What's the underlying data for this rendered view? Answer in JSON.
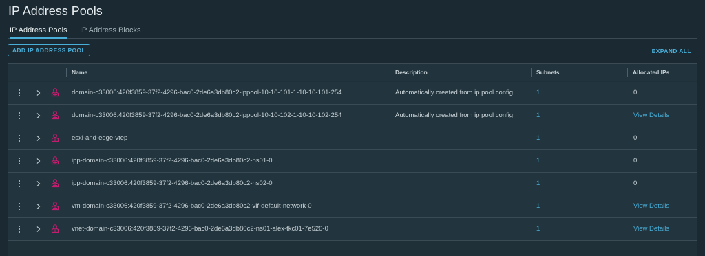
{
  "page": {
    "title": "IP Address Pools"
  },
  "tabs": [
    {
      "label": "IP Address Pools",
      "active": true
    },
    {
      "label": "IP Address Blocks",
      "active": false
    }
  ],
  "toolbar": {
    "add_label": "ADD IP ADDRESS POOL",
    "expand_all_label": "EXPAND ALL"
  },
  "grid": {
    "columns": [
      "Name",
      "Description",
      "Subnets",
      "Allocated IPs"
    ],
    "rows": [
      {
        "name": "domain-c33006:420f3859-37f2-4296-bac0-2de6a3db80c2-ippool-10-10-101-1-10-10-101-254",
        "description": "Automatically created from ip pool config",
        "subnets": "1",
        "allocated": "0",
        "allocated_is_link": false
      },
      {
        "name": "domain-c33006:420f3859-37f2-4296-bac0-2de6a3db80c2-ippool-10-10-102-1-10-10-102-254",
        "description": "Automatically created from ip pool config",
        "subnets": "1",
        "allocated": "View Details",
        "allocated_is_link": true
      },
      {
        "name": "esxi-and-edge-vtep",
        "description": "",
        "subnets": "1",
        "allocated": "0",
        "allocated_is_link": false
      },
      {
        "name": "ipp-domain-c33006:420f3859-37f2-4296-bac0-2de6a3db80c2-ns01-0",
        "description": "",
        "subnets": "1",
        "allocated": "0",
        "allocated_is_link": false
      },
      {
        "name": "ipp-domain-c33006:420f3859-37f2-4296-bac0-2de6a3db80c2-ns02-0",
        "description": "",
        "subnets": "1",
        "allocated": "0",
        "allocated_is_link": false
      },
      {
        "name": "vm-domain-c33006:420f3859-37f2-4296-bac0-2de6a3db80c2-vif-default-network-0",
        "description": "",
        "subnets": "1",
        "allocated": "View Details",
        "allocated_is_link": true
      },
      {
        "name": "vnet-domain-c33006:420f3859-37f2-4296-bac0-2de6a3db80c2-ns01-alex-tkc01-7e520-0",
        "description": "",
        "subnets": "1",
        "allocated": "View Details",
        "allocated_is_link": true
      }
    ]
  },
  "colors": {
    "accent": "#49afd9",
    "pool_icon": "#c21d6f",
    "background": "#1b2a32"
  }
}
